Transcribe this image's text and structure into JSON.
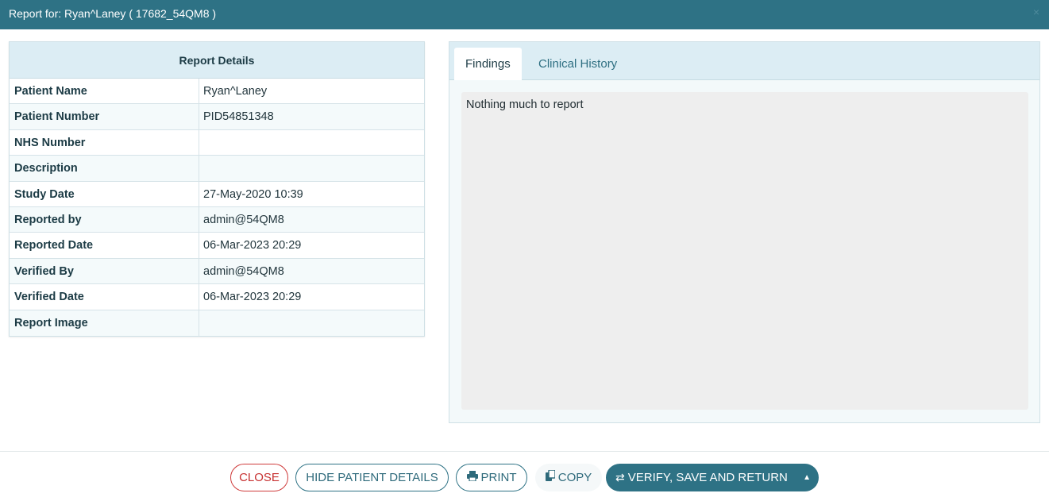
{
  "window": {
    "title": "Report for: Ryan^Laney ( 17682_54QM8 )",
    "close_glyph": "×"
  },
  "details": {
    "header": "Report Details",
    "rows": [
      {
        "label": "Patient Name",
        "value": "Ryan^Laney"
      },
      {
        "label": "Patient Number",
        "value": "PID54851348"
      },
      {
        "label": "NHS Number",
        "value": ""
      },
      {
        "label": "Description",
        "value": ""
      },
      {
        "label": "Study Date",
        "value": "27-May-2020 10:39"
      },
      {
        "label": "Reported by",
        "value": "admin@54QM8"
      },
      {
        "label": "Reported Date",
        "value": "06-Mar-2023 20:29"
      },
      {
        "label": "Verified By",
        "value": "admin@54QM8"
      },
      {
        "label": "Verified Date",
        "value": "06-Mar-2023 20:29"
      },
      {
        "label": "Report Image",
        "value": ""
      }
    ]
  },
  "tabs": [
    {
      "label": "Findings",
      "active": true
    },
    {
      "label": "Clinical History",
      "active": false
    }
  ],
  "findings": {
    "text": "Nothing much to report"
  },
  "footer": {
    "close_label": "CLOSE",
    "hide_label": "HIDE PATIENT DETAILS",
    "print_label": "PRINT",
    "copy_label": "COPY",
    "verify_label": "VERIFY, SAVE AND RETURN"
  },
  "icons": {
    "print": "print-icon",
    "copy": "copy-icon",
    "verify": "swap-arrows-icon",
    "caret": "caret-up-icon"
  },
  "colors": {
    "header": "#2e7285",
    "close_red": "#c73131",
    "accent": "#2e6a7b"
  }
}
